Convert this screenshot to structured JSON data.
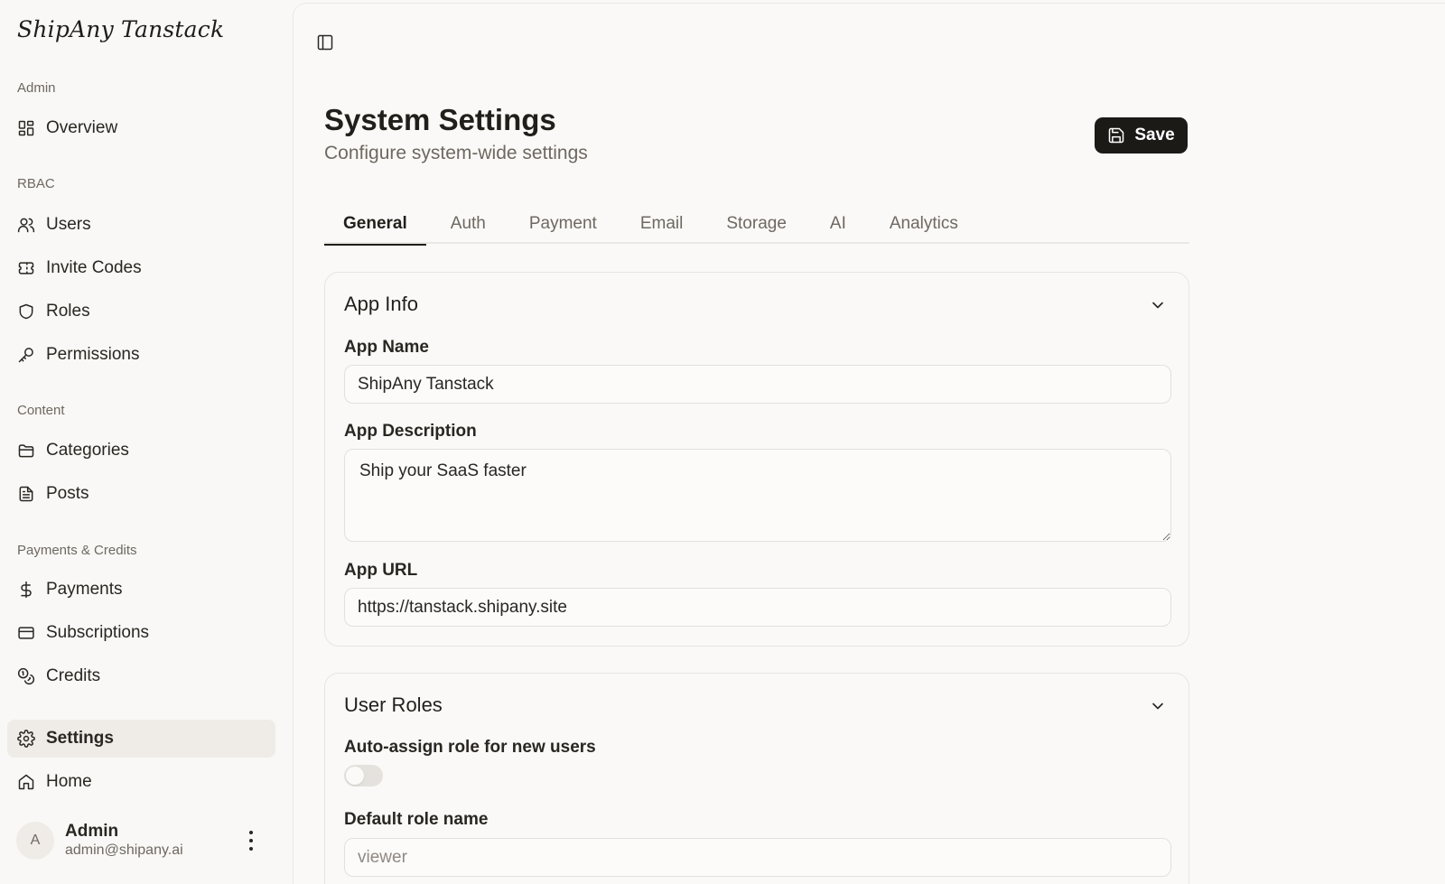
{
  "app": {
    "brand": "ShipAny Tanstack"
  },
  "sidebar": {
    "groups": [
      {
        "label": "Admin"
      },
      {
        "label": "RBAC"
      },
      {
        "label": "Content"
      },
      {
        "label": "Payments & Credits"
      }
    ],
    "items": [
      {
        "label": "Overview",
        "icon": "layout-grid-icon"
      },
      {
        "label": "Users",
        "icon": "users-icon"
      },
      {
        "label": "Invite Codes",
        "icon": "ticket-icon"
      },
      {
        "label": "Roles",
        "icon": "shield-icon"
      },
      {
        "label": "Permissions",
        "icon": "key-icon"
      },
      {
        "label": "Categories",
        "icon": "folder-icon"
      },
      {
        "label": "Posts",
        "icon": "file-text-icon"
      },
      {
        "label": "Payments",
        "icon": "dollar-icon"
      },
      {
        "label": "Subscriptions",
        "icon": "credit-card-icon"
      },
      {
        "label": "Credits",
        "icon": "coins-icon"
      },
      {
        "label": "Settings",
        "icon": "gear-icon",
        "active": true
      },
      {
        "label": "Home",
        "icon": "home-icon"
      }
    ],
    "user": {
      "initial": "A",
      "name": "Admin",
      "email": "admin@shipany.ai"
    }
  },
  "header": {
    "title": "System Settings",
    "subtitle": "Configure system-wide settings",
    "save_label": "Save"
  },
  "tabs": [
    {
      "label": "General",
      "active": true
    },
    {
      "label": "Auth"
    },
    {
      "label": "Payment"
    },
    {
      "label": "Email"
    },
    {
      "label": "Storage"
    },
    {
      "label": "AI"
    },
    {
      "label": "Analytics"
    }
  ],
  "app_info": {
    "title": "App Info",
    "app_name_label": "App Name",
    "app_name_value": "ShipAny Tanstack",
    "app_description_label": "App Description",
    "app_description_value": "Ship your SaaS faster",
    "app_url_label": "App URL",
    "app_url_value": "https://tanstack.shipany.site"
  },
  "user_roles": {
    "title": "User Roles",
    "auto_assign_label": "Auto-assign role for new users",
    "auto_assign_enabled": false,
    "default_role_label": "Default role name",
    "default_role_placeholder": "viewer"
  },
  "colors": {
    "accent": "#1c1a17",
    "background": "#f9f8f6",
    "active_nav": "#efece8"
  }
}
